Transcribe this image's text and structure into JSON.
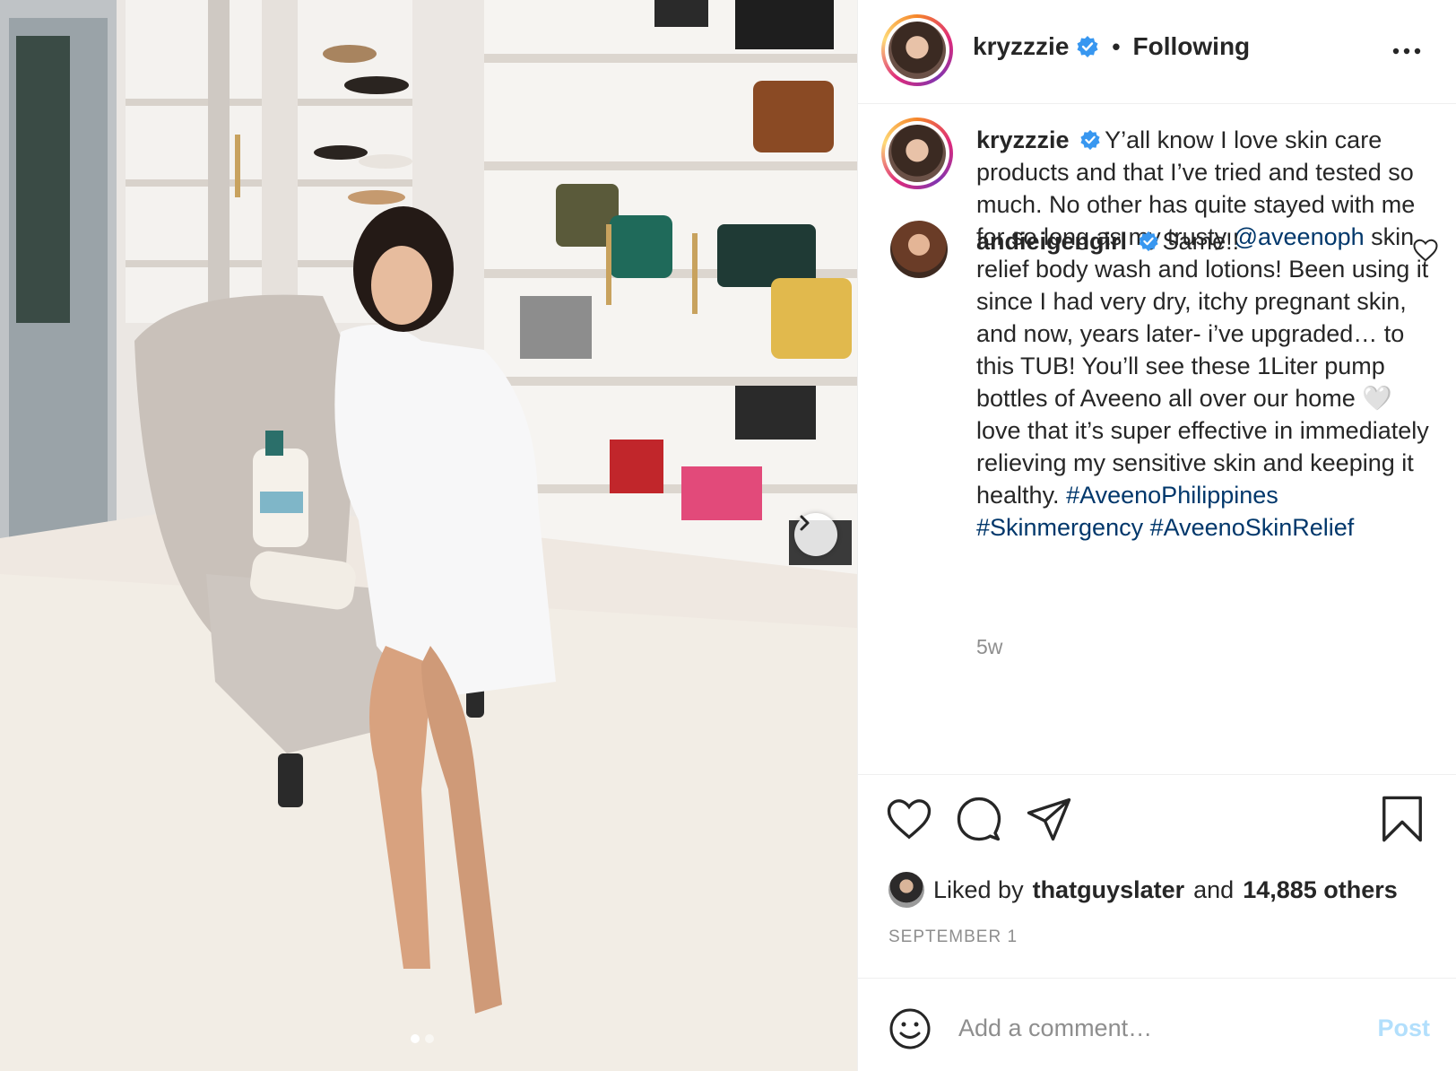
{
  "post": {
    "username": "kryzzzie",
    "verified": true,
    "separator": "•",
    "follow_status": "Following"
  },
  "caption": {
    "username": "kryzzzie",
    "text_1": "Y’all know I love skin care products and that I’ve tried and tested so much. No other has quite stayed with me for so long as my trusty ",
    "mention": "@aveenoph",
    "text_2": " skin relief body wash and lotions! Been using it since I had very dry, itchy pregnant skin, and now, years later- i’ve upgraded… to this TUB! You’ll see these 1Liter pump bottles of Aveeno all over our home 🤍 love that it’s super effective in immediately relieving my sensitive skin and keeping it healthy. ",
    "hashtag_1": "#AveenoPhilippines",
    "hashtag_2": "#Skinmergency",
    "hashtag_3": "#AveenoSkinRelief",
    "age": "5w"
  },
  "comments": [
    {
      "username": "andieigengirl",
      "verified": true,
      "text": "Same!!"
    }
  ],
  "actions": {
    "icons": [
      "heart-icon",
      "comment-icon",
      "share-icon",
      "bookmark-icon"
    ]
  },
  "likes": {
    "prefix": "Liked by",
    "user": "thatguyslater",
    "conjunction": "and",
    "others": "14,885 others"
  },
  "date": "SEPTEMBER 1",
  "add_comment": {
    "placeholder": "Add a comment…",
    "post_label": "Post"
  },
  "carousel": {
    "current": 1,
    "total": 2
  },
  "colors": {
    "verified": "#3897f0",
    "link": "#00376b",
    "muted": "#8e8e8e",
    "post_disabled": "#b2dffc"
  }
}
